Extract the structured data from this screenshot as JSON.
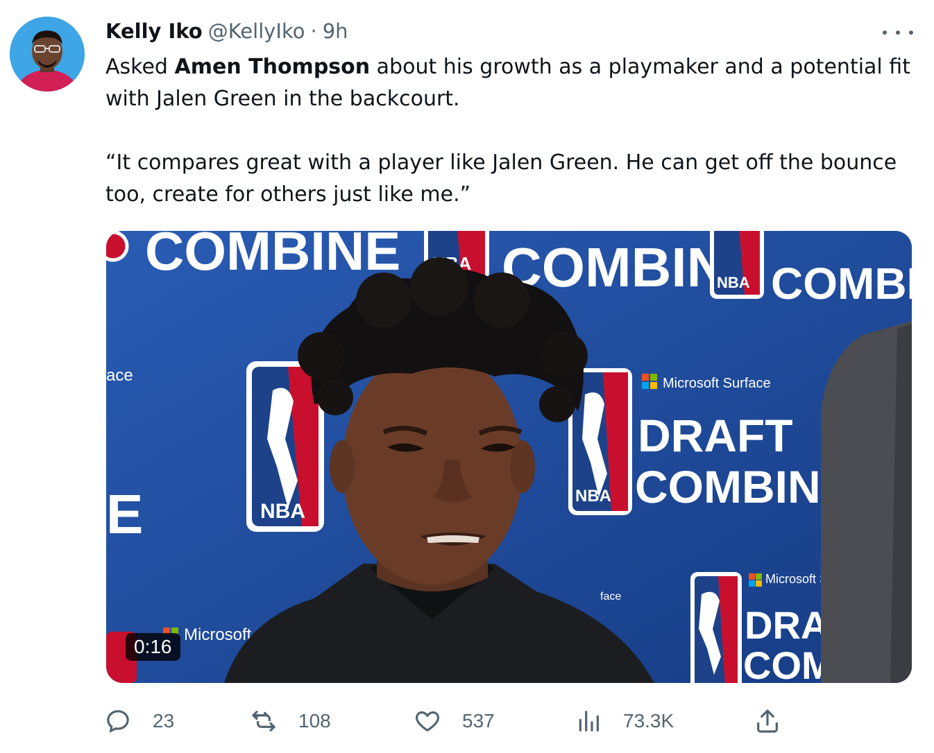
{
  "author": {
    "display_name": "Kelly Iko",
    "handle": "@KellyIko",
    "separator": "·",
    "time": "9h"
  },
  "tweet": {
    "line1_prefix": "Asked ",
    "line1_bold": "Amen Thompson",
    "line1_suffix": " about his growth as a playmaker and a potential fit with Jalen Green in the backcourt.",
    "quote": "“It compares great with a player like Jalen Green. He can get off the bounce too, create for others just like me.”"
  },
  "media": {
    "type": "video",
    "duration": "0:16",
    "backdrop_text": {
      "combine": "COMBINE",
      "nba": "NBA",
      "draft": "DRAFT",
      "microsoft_surface": "Microsoft Surface",
      "microsoft_sur": "Microsoft Sur",
      "microsoft": "Microsoft",
      "face": "face",
      "ace": "ace",
      "e": "E"
    }
  },
  "actions": {
    "reply": {
      "icon": "reply-icon",
      "count": "23"
    },
    "retweet": {
      "icon": "retweet-icon",
      "count": "108"
    },
    "like": {
      "icon": "heart-icon",
      "count": "537"
    },
    "views": {
      "icon": "views-icon",
      "count": "73.3K"
    },
    "share": {
      "icon": "share-icon"
    }
  },
  "colors": {
    "text": "#0f1419",
    "secondary": "#536471",
    "backdrop_blue": "#1f4fa0",
    "nba_red": "#c8102e"
  }
}
